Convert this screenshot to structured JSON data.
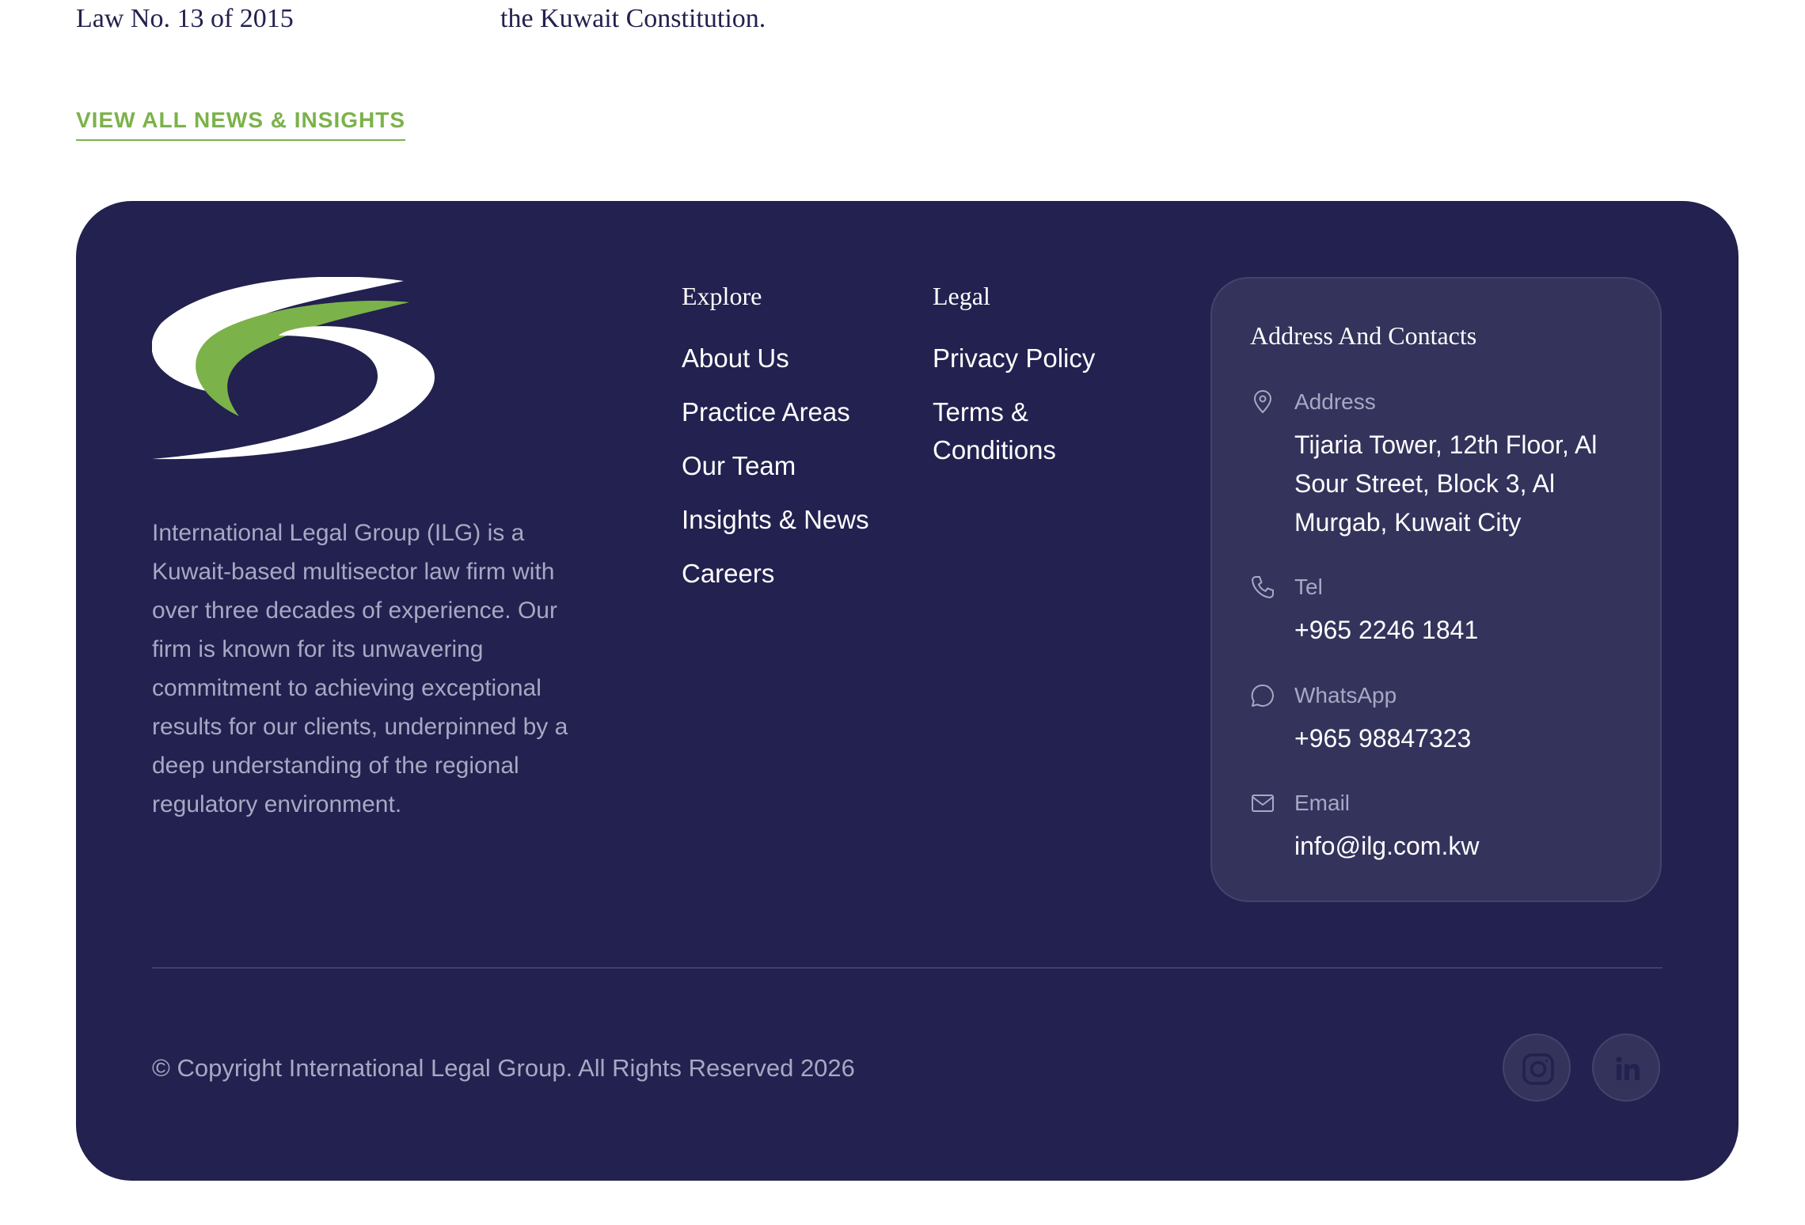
{
  "news": {
    "left_meta": "Law No. 13 of 2015",
    "right_excerpt": "the Kuwait Constitution.",
    "view_all_label": "VIEW ALL NEWS & INSIGHTS"
  },
  "footer": {
    "about_text": "International Legal Group (ILG) is a Kuwait-based multisector law firm with over three decades of experience. Our firm is known for its unwavering commitment to achieving exceptional results for our clients, underpinned by a deep understanding of the regional regulatory environment.",
    "explore": {
      "title": "Explore",
      "links": [
        "About Us",
        "Practice Areas",
        "Our Team",
        "Insights & News",
        "Careers"
      ]
    },
    "legal": {
      "title": "Legal",
      "links": [
        "Privacy Policy",
        "Terms & Conditions"
      ]
    },
    "contacts": {
      "title": "Address And Contacts",
      "address_label": "Address",
      "address_value": "Tijaria Tower, 12th Floor, Al Sour Street, Block 3, Al Murgab, Kuwait City",
      "tel_label": "Tel",
      "tel_value": "+965 2246 1841",
      "whatsapp_label": "WhatsApp",
      "whatsapp_value": "+965 98847323",
      "email_label": "Email",
      "email_value": "info@ilg.com.kw"
    },
    "copyright": "© Copyright International Legal Group. All Rights Reserved 2026",
    "social_icons": [
      "instagram-icon",
      "linkedin-icon"
    ]
  },
  "colors": {
    "footer_bg": "#22214f",
    "card_bg": "#33335c",
    "accent_green": "#7cb24a",
    "muted_text": "#a8a8c4"
  }
}
